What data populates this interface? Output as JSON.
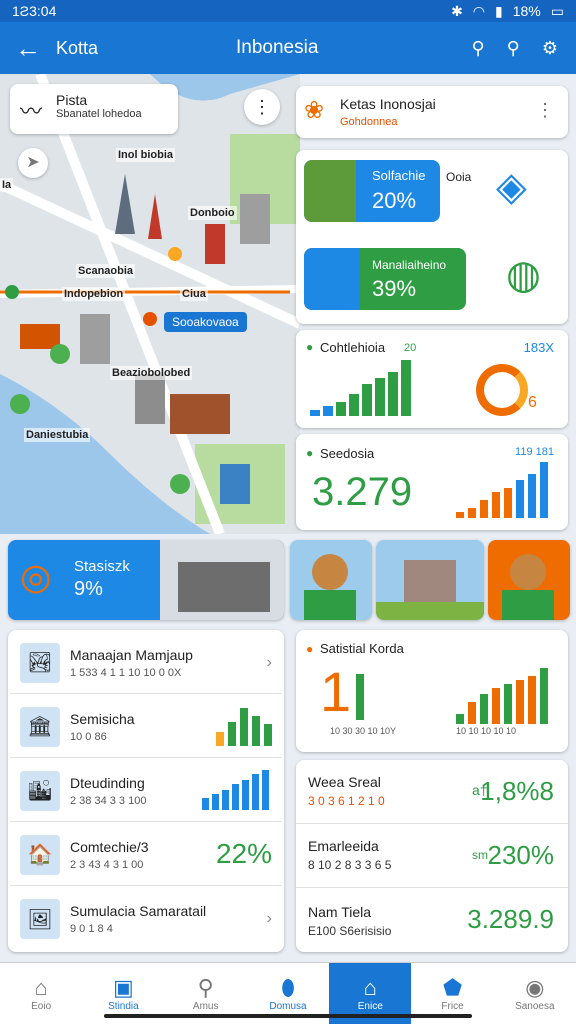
{
  "status": {
    "time": "1Ƨ3:04",
    "battery": "18%"
  },
  "appbar": {
    "back_glyph": "←",
    "title": "Kotta",
    "center": "Inbonesia"
  },
  "map": {
    "card_title": "Pista",
    "card_sub": "Sbanatel lohedoa",
    "labels": [
      "Inol biobia",
      "Donboio",
      "Scanaobia",
      "Indopebion",
      "Ciua",
      "Sooakovaoa",
      "Beaziobolobed",
      "Daniestubia",
      "Ιa"
    ]
  },
  "kota_card": {
    "title": "Ketas Inonosjai",
    "sub": "Gohdonnea"
  },
  "promo1": {
    "title": "Solfachie",
    "value": "20%",
    "side": "Ooia"
  },
  "promo2": {
    "title": "Manaliaiheino",
    "value": "39%"
  },
  "chart1": {
    "title": "Cohtlehioia",
    "top": "20",
    "right": "183X",
    "ring_value": "6"
  },
  "chart2": {
    "title": "Seedosia",
    "value": "3.279",
    "top": "119 181"
  },
  "banner": {
    "title": "Stasiszk",
    "value": "9%"
  },
  "list": [
    {
      "title": "Manaajan Mamjaup",
      "sub": "1 533 4 1 1 10 10 0 0X",
      "icon": "🏞"
    },
    {
      "title": "Semisicha",
      "sub": "10 0 86",
      "icon": "🏛"
    },
    {
      "title": "Dteudinding",
      "sub": "2 38 34 3 3 100",
      "icon": "🏙"
    },
    {
      "title": "Comtechie/3",
      "sub": "2 3 43 4 3 1 00",
      "icon": "🏠",
      "value": "22%"
    },
    {
      "title": "Sumulacia Samaratail",
      "sub": "9 0 1 8 4",
      "icon": "🖼"
    }
  ],
  "chart3": {
    "title": "Satistial Korda",
    "big": "1",
    "axis_left": "10 30 30 10 10Y",
    "axis_right": "10 10 10 10 10"
  },
  "stats": [
    {
      "title": "Weea Sreal",
      "sub": "3 0 3 6 1 2 1 0",
      "prefix": "а†",
      "value": "1,8%8",
      "sub_color": "#e65100"
    },
    {
      "title": "Emarleeida",
      "sub": "8 10 2 8 3 3 6 5",
      "prefix": "sm",
      "value": "230%",
      "sub_color": "#333"
    },
    {
      "title": "Nam Tiela",
      "sub": "E100 S6erisisio",
      "prefix": "",
      "value": "3.289.9",
      "sub_color": "#333"
    }
  ],
  "nav": [
    {
      "label": "Eoio",
      "icon": "⌂"
    },
    {
      "label": "Stindia",
      "icon": "▣"
    },
    {
      "label": "Amus",
      "icon": "⚲"
    },
    {
      "label": "Domusa",
      "icon": "⬮"
    },
    {
      "label": "Enice",
      "icon": "⌂"
    },
    {
      "label": "Frice",
      "icon": "⬟"
    },
    {
      "label": "Sanoesa",
      "icon": "◉"
    }
  ],
  "colors": {
    "primary": "#1976d2",
    "green": "#2e9d44",
    "orange": "#ef6c00",
    "blue": "#1e88e5"
  }
}
